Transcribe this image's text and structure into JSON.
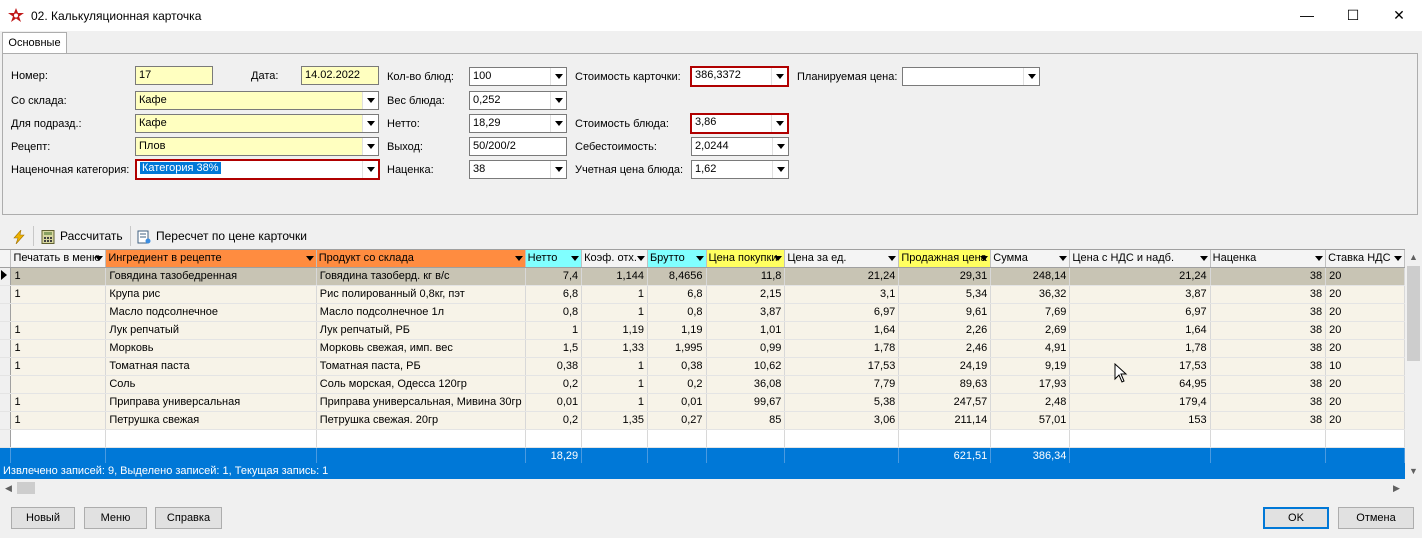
{
  "window": {
    "title": "02. Калькуляционная карточка",
    "minimize": "—",
    "maximize": "☐",
    "close": "✕"
  },
  "tabs": [
    {
      "label": "Основные"
    }
  ],
  "form": {
    "number_label": "Номер:",
    "number_value": "17",
    "date_label": "Дата:",
    "date_value": "14.02.2022",
    "warehouse_label": "Со склада:",
    "warehouse_value": "Кафе",
    "subdivision_label": "Для подразд.:",
    "subdivision_value": "Кафе",
    "recipe_label": "Рецепт:",
    "recipe_value": "Плов",
    "markup_category_label": "Наценочная категория:",
    "markup_category_value": "Категория 38%",
    "dish_count_label": "Кол-во блюд:",
    "dish_count_value": "100",
    "dish_weight_label": "Вес блюда:",
    "dish_weight_value": "0,252",
    "net_label": "Нетто:",
    "net_value": "18,29",
    "yield_label": "Выход:",
    "yield_value": "50/200/2",
    "markup_label": "Наценка:",
    "markup_value": "38",
    "card_cost_label": "Стоимость карточки:",
    "card_cost_value": "386,3372",
    "dish_cost_label": "Стоимость блюда:",
    "dish_cost_value": "3,86",
    "self_cost_label": "Себестоимость:",
    "self_cost_value": "2,0244",
    "account_price_label": "Учетная цена блюда:",
    "account_price_value": "1,62",
    "planned_price_label": "Планируемая цена:",
    "planned_price_value": ""
  },
  "toolbar": {
    "calculate": "Рассчитать",
    "recalc": "Пересчет по цене карточки"
  },
  "grid": {
    "columns": [
      {
        "label": "Печатать в меню",
        "bg": "#f4f4f4"
      },
      {
        "label": "Ингредиент в рецепте",
        "bg": "#ff8c40"
      },
      {
        "label": "Продукт со склада",
        "bg": "#ff8c40"
      },
      {
        "label": "Нетто",
        "bg": "#80ffff"
      },
      {
        "label": "Коэф. отх.",
        "bg": "#f4f4f4"
      },
      {
        "label": "Брутто",
        "bg": "#80ffff"
      },
      {
        "label": "Цена покупки",
        "bg": "#ffff60"
      },
      {
        "label": "Цена за ед.",
        "bg": "#f4f4f4"
      },
      {
        "label": "Продажная цена",
        "bg": "#ffff60"
      },
      {
        "label": "Сумма",
        "bg": "#f4f4f4"
      },
      {
        "label": "Цена с НДС и надб.",
        "bg": "#f4f4f4"
      },
      {
        "label": "Наценка",
        "bg": "#f4f4f4"
      },
      {
        "label": "Ставка НДС",
        "bg": "#f4f4f4"
      }
    ],
    "rows": [
      [
        "1",
        "Говядина тазобедренная",
        "Говядина тазоберд. кг в/с",
        "7,4",
        "1,144",
        "8,4656",
        "11,8",
        "21,24",
        "29,31",
        "248,14",
        "21,24",
        "38",
        "20"
      ],
      [
        "1",
        "Крупа рис",
        "Рис полированный 0,8кг, пэт",
        "6,8",
        "1",
        "6,8",
        "2,15",
        "3,1",
        "5,34",
        "36,32",
        "3,87",
        "38",
        "20"
      ],
      [
        "",
        "Масло подсолнечное",
        "Масло подсолнечное 1л",
        "0,8",
        "1",
        "0,8",
        "3,87",
        "6,97",
        "9,61",
        "7,69",
        "6,97",
        "38",
        "20"
      ],
      [
        "1",
        "Лук репчатый",
        "Лук репчатый, РБ",
        "1",
        "1,19",
        "1,19",
        "1,01",
        "1,64",
        "2,26",
        "2,69",
        "1,64",
        "38",
        "20"
      ],
      [
        "1",
        "Морковь",
        "Морковь свежая, имп. вес",
        "1,5",
        "1,33",
        "1,995",
        "0,99",
        "1,78",
        "2,46",
        "4,91",
        "1,78",
        "38",
        "20"
      ],
      [
        "1",
        "Томатная паста",
        "Томатная паста, РБ",
        "0,38",
        "1",
        "0,38",
        "10,62",
        "17,53",
        "24,19",
        "9,19",
        "17,53",
        "38",
        "10"
      ],
      [
        "",
        "Соль",
        "Соль морская, Одесса 120гр",
        "0,2",
        "1",
        "0,2",
        "36,08",
        "7,79",
        "89,63",
        "17,93",
        "64,95",
        "38",
        "20"
      ],
      [
        "1",
        "Приправа универсальная",
        "Приправа универсальная, Мивина 30гр",
        "0,01",
        "1",
        "0,01",
        "99,67",
        "5,38",
        "247,57",
        "2,48",
        "179,4",
        "38",
        "20"
      ],
      [
        "1",
        "Петрушка свежая",
        "Петрушка свежая. 20гр",
        "0,2",
        "1,35",
        "0,27",
        "85",
        "3,06",
        "211,14",
        "57,01",
        "153",
        "38",
        "20"
      ]
    ],
    "totals": [
      "",
      "",
      "",
      "18,29",
      "",
      "",
      "",
      "",
      "621,51",
      "386,34",
      "",
      "",
      ""
    ]
  },
  "status": "Извлечено записей: 9, Выделено записей: 1, Текущая запись: 1",
  "buttons": {
    "new": "Новый",
    "menu": "Меню",
    "help": "Справка",
    "ok": "OK",
    "cancel": "Отмена"
  }
}
